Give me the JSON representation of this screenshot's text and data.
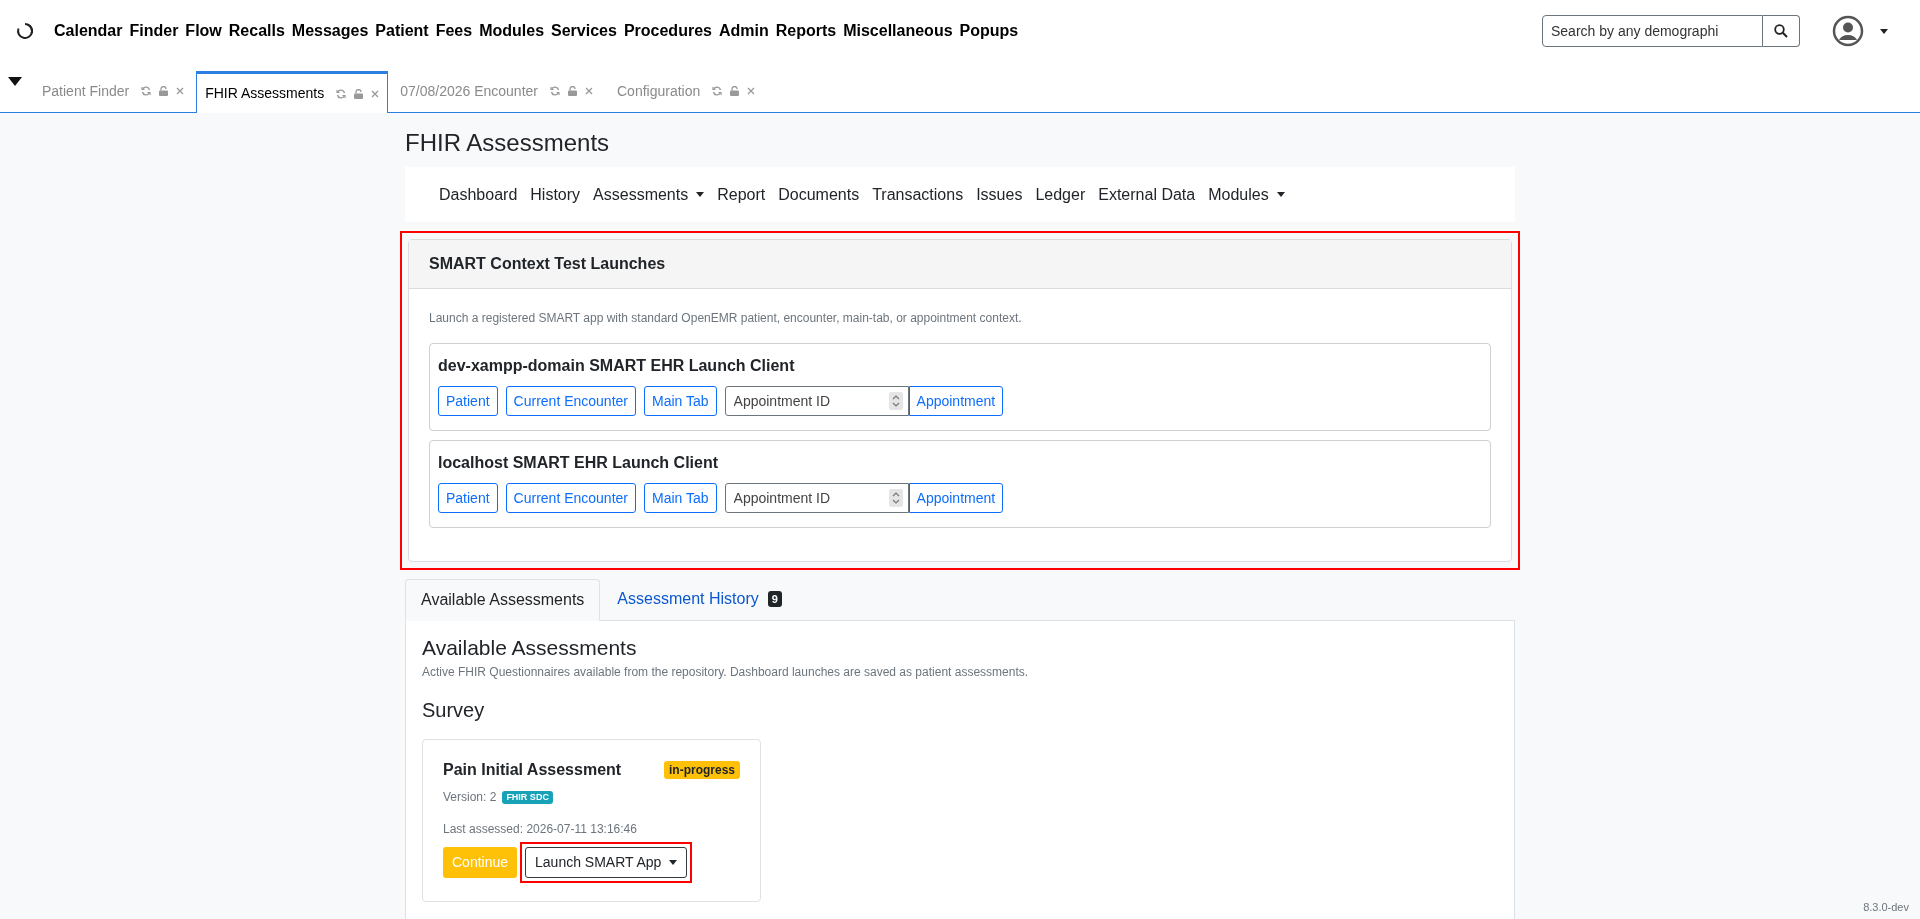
{
  "menu": [
    "Calendar",
    "Finder",
    "Flow",
    "Recalls",
    "Messages",
    "Patient",
    "Fees",
    "Modules",
    "Services",
    "Procedures",
    "Admin",
    "Reports",
    "Miscellaneous",
    "Popups"
  ],
  "search": {
    "placeholder": "Search by any demographi"
  },
  "tabs": [
    {
      "label": "Patient Finder",
      "selected": false
    },
    {
      "label": "FHIR Assessments",
      "selected": true
    },
    {
      "label": "07/08/2026 Encounter",
      "selected": false
    },
    {
      "label": "Configuration",
      "selected": false
    }
  ],
  "page_title": "FHIR Assessments",
  "nav": [
    {
      "label": "Dashboard",
      "dropdown": false
    },
    {
      "label": "History",
      "dropdown": false
    },
    {
      "label": "Assessments",
      "dropdown": true
    },
    {
      "label": "Report",
      "dropdown": false
    },
    {
      "label": "Documents",
      "dropdown": false
    },
    {
      "label": "Transactions",
      "dropdown": false
    },
    {
      "label": "Issues",
      "dropdown": false
    },
    {
      "label": "Ledger",
      "dropdown": false
    },
    {
      "label": "External Data",
      "dropdown": false
    },
    {
      "label": "Modules",
      "dropdown": true
    }
  ],
  "smart_panel": {
    "title": "SMART Context Test Launches",
    "highlighted": true,
    "description": "Launch a registered SMART app with standard OpenEMR patient, encounter, main-tab, or appointment context.",
    "clients": [
      {
        "name": "dev-xampp-domain SMART EHR Launch Client",
        "buttons": [
          "Patient",
          "Current Encounter",
          "Main Tab"
        ],
        "appointment_placeholder": "Appointment ID",
        "appointment_button": "Appointment"
      },
      {
        "name": "localhost SMART EHR Launch Client",
        "buttons": [
          "Patient",
          "Current Encounter",
          "Main Tab"
        ],
        "appointment_placeholder": "Appointment ID",
        "appointment_button": "Appointment"
      }
    ]
  },
  "content_tabs": [
    {
      "label": "Available Assessments",
      "selected": true
    },
    {
      "label": "Assessment History",
      "selected": false,
      "count": "9"
    }
  ],
  "section": {
    "title": "Available Assessments",
    "description": "Active FHIR Questionnaires available from the repository. Dashboard launches are saved as patient assessments.",
    "group": "Survey",
    "cards": [
      {
        "title": "Pain Initial Assessment",
        "status": "in-progress",
        "version": "Version: 2",
        "tag": "FHIR SDC",
        "last_assessed": "Last assessed: 2026-07-11 13:16:46",
        "primary_button": "Continue",
        "launch_button": "Launch SMART App",
        "launch_highlighted": true
      }
    ]
  },
  "version": "8.3.0-dev"
}
